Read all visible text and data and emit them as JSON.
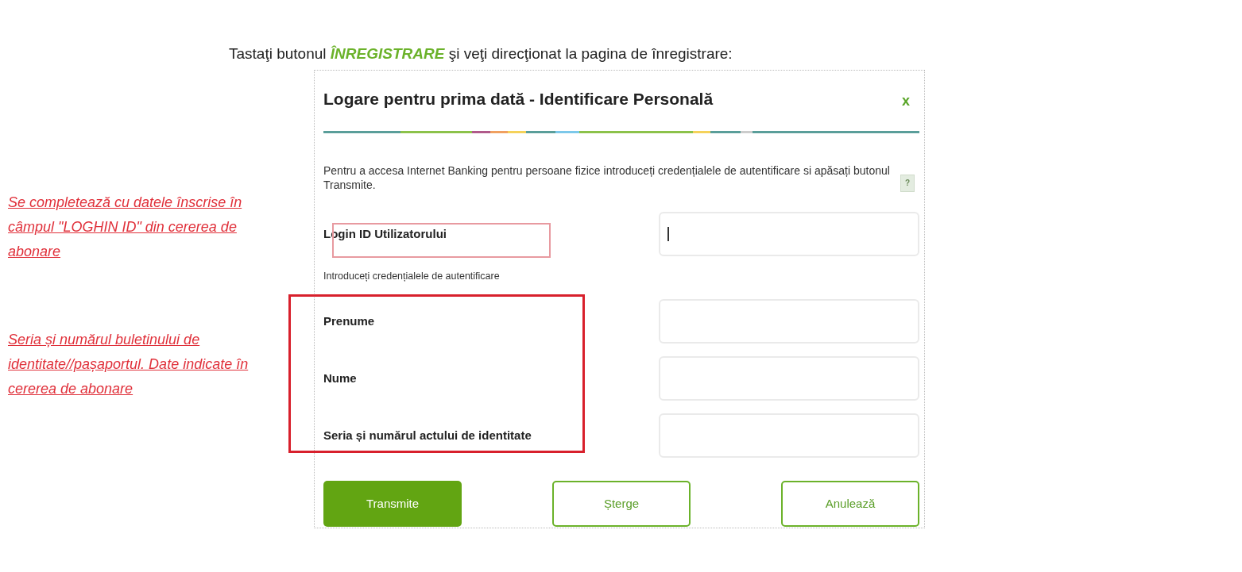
{
  "instruction": "Tastaţi butonul **ÎNREGISTRARE** şi veţi direcţionat la pagina de înregistrare:",
  "notes": [
    {
      "text": "Se completează cu datele înscrise în câmpul \"LOGHIN ID\" din cererea de abonare"
    },
    {
      "text": "Seria și numărul buletinului de identitate//pașaportul. Date indicate în cererea de abonare"
    }
  ],
  "dialog": {
    "title": "Logare pentru prima dată - Identificare Personală",
    "close": "x",
    "description": "Pentru a accesa Internet Banking pentru persoane fizice introduceți credențialele de autentificare si apăsați butonul Transmite.",
    "help": "?",
    "login": {
      "label": "Login ID Utilizatorului",
      "focused": true
    },
    "hint": "Introduceți credențialele de autentificare",
    "fields": [
      {
        "label": "Prenume"
      },
      {
        "label": "Nume"
      },
      {
        "label": "Seria și numărul actului de identitate"
      }
    ],
    "buttons": [
      {
        "label": "Transmite",
        "kind": "primary"
      },
      {
        "label": "Șterge",
        "kind": "outline"
      },
      {
        "label": "Anulează",
        "kind": "outline"
      }
    ]
  }
}
